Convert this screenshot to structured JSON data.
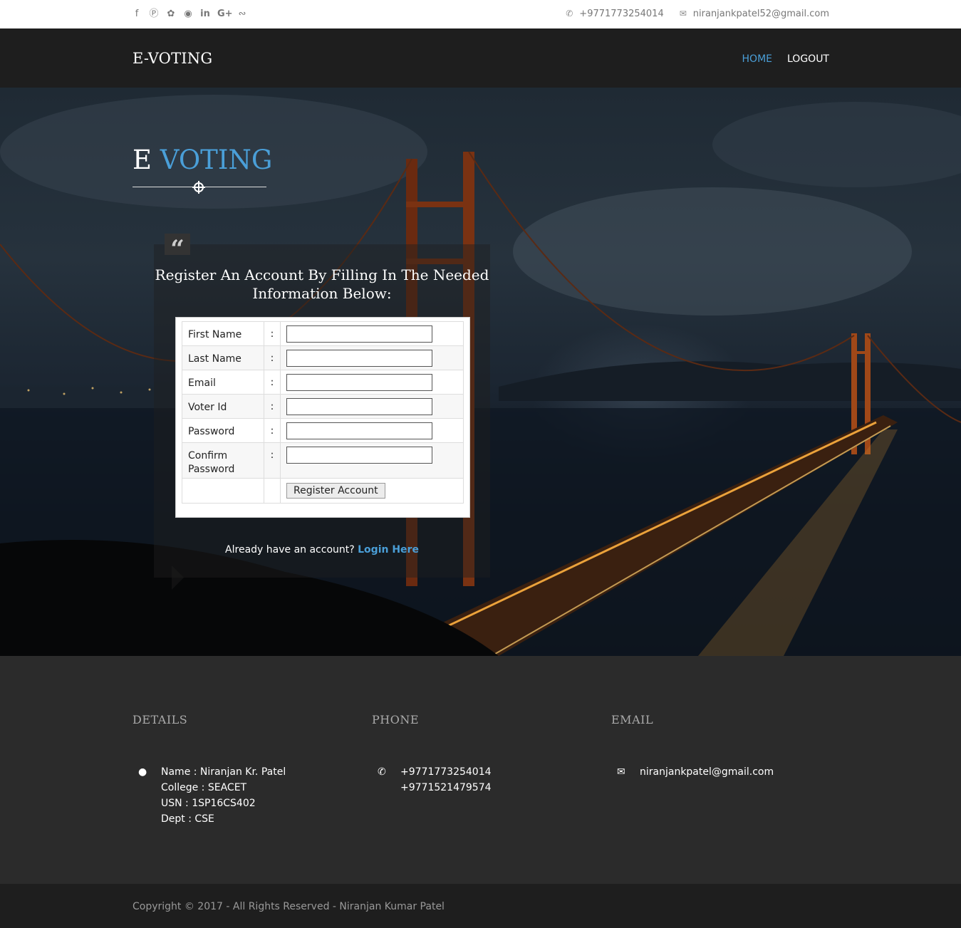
{
  "topbar": {
    "social_icons": [
      "facebook-icon",
      "pinterest-icon",
      "twitter-icon",
      "dribbble-icon",
      "linkedin-icon",
      "google-plus-icon",
      "rss-icon"
    ],
    "phone": "+9771773254014",
    "email": "niranjankpatel52@gmail.com"
  },
  "navbar": {
    "brand": "E-VOTING",
    "links": [
      {
        "label": "HOME",
        "active": true
      },
      {
        "label": "LOGOUT",
        "active": false
      }
    ]
  },
  "hero": {
    "title_part1": "E",
    "title_part2": "VOTING",
    "register_title": "Register An Account By Filling In The Needed Information Below:",
    "form": {
      "fields": [
        {
          "label": "First Name",
          "value": ""
        },
        {
          "label": "Last Name",
          "value": ""
        },
        {
          "label": "Email",
          "value": ""
        },
        {
          "label": "Voter Id",
          "value": ""
        },
        {
          "label": "Password",
          "value": ""
        },
        {
          "label": "Confirm Password",
          "value": ""
        }
      ],
      "colon": ":",
      "submit_label": "Register Account"
    },
    "already_text": "Already have an account?",
    "login_link": "Login Here"
  },
  "footer": {
    "details": {
      "heading": "DETAILS",
      "lines": [
        "Name : Niranjan Kr. Patel",
        "College : SEACET",
        "USN : 1SP16CS402",
        "Dept : CSE"
      ]
    },
    "phone": {
      "heading": "PHONE",
      "lines": [
        "+9771773254014",
        "+9771521479574"
      ]
    },
    "email": {
      "heading": "EMAIL",
      "lines": [
        "niranjankpatel@gmail.com"
      ]
    },
    "copyright": "Copyright © 2017 - All Rights Reserved - Niranjan Kumar Patel"
  },
  "colors": {
    "accent": "#4a9fd8",
    "nav_bg": "#1e1e1e",
    "footer_bg": "#2b2b2b"
  }
}
